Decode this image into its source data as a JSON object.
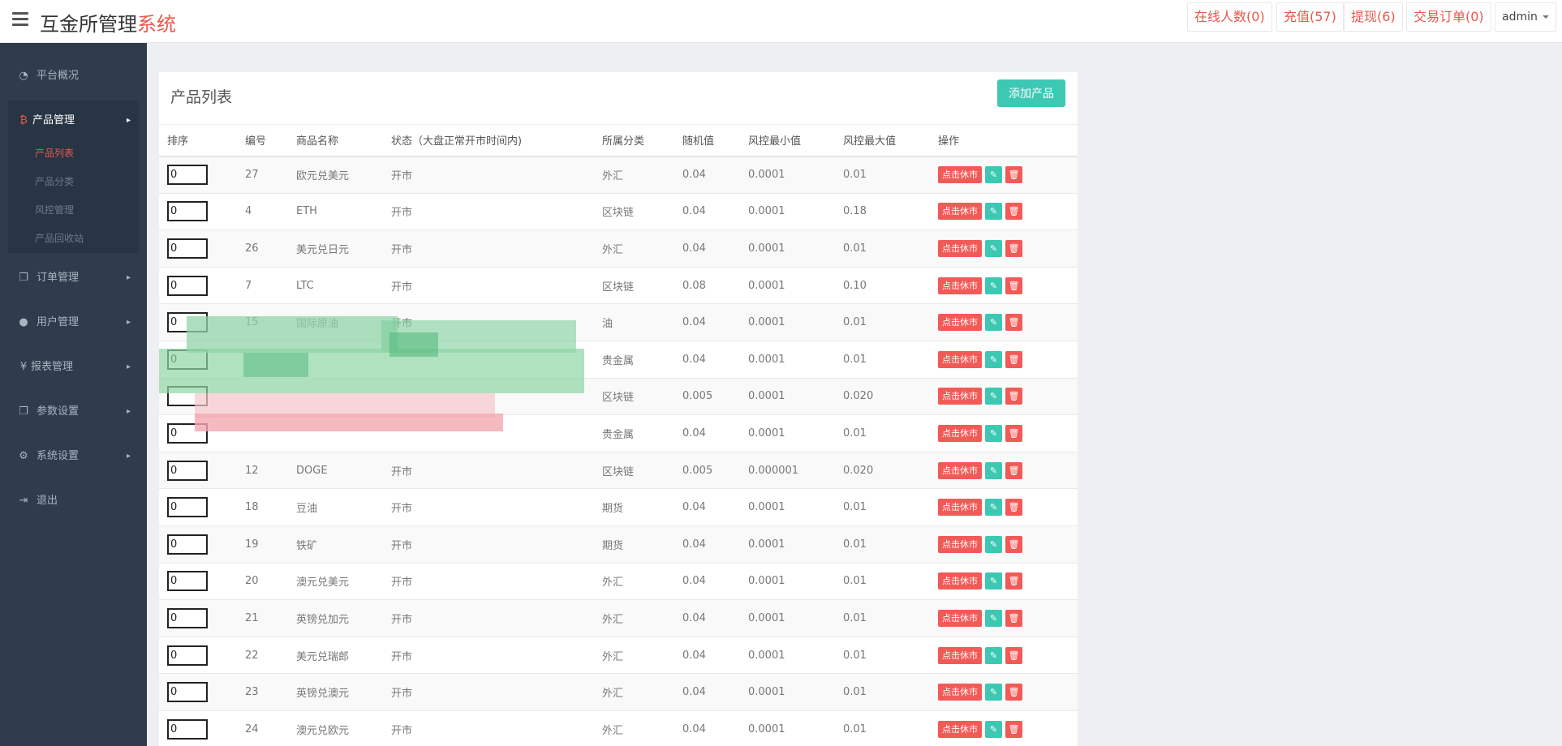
{
  "header": {
    "title_main": "互金所管理",
    "title_accent": "系统",
    "buttons": [
      {
        "label": "在线人数(0)"
      },
      {
        "label": "充值(57)"
      },
      {
        "label": "提现(6)"
      },
      {
        "label": "交易订单(0)"
      }
    ],
    "user": "admin"
  },
  "sidebar": {
    "items": [
      {
        "label": "平台概况",
        "icon": "dashboard-icon"
      },
      {
        "label": "产品管理",
        "icon": "bitcoin-icon"
      },
      {
        "label": "订单管理",
        "icon": "copy-icon"
      },
      {
        "label": "用户管理",
        "icon": "user-icon"
      },
      {
        "label": "报表管理",
        "icon": "yen-icon"
      },
      {
        "label": "参数设置",
        "icon": "copy-icon"
      },
      {
        "label": "系统设置",
        "icon": "cogs-icon"
      },
      {
        "label": "退出",
        "icon": "sign-out-icon"
      }
    ],
    "sub_items": [
      {
        "label": "产品列表"
      },
      {
        "label": "产品分类"
      },
      {
        "label": "风控管理"
      },
      {
        "label": "产品回收站"
      }
    ]
  },
  "panel": {
    "title": "产品列表",
    "add_button": "添加产品",
    "columns": [
      "排序",
      "编号",
      "商品名称",
      "状态（大盘正常开市时间内)",
      "所属分类",
      "随机值",
      "风控最小值",
      "风控最大值",
      "操作"
    ],
    "close_label": "点击休市",
    "rows": [
      {
        "sort": "0",
        "id": "27",
        "name": "欧元兑美元",
        "status": "开市",
        "category": "外汇",
        "random": "0.04",
        "min": "0.0001",
        "max": "0.01"
      },
      {
        "sort": "0",
        "id": "4",
        "name": "ETH",
        "status": "开市",
        "category": "区块链",
        "random": "0.04",
        "min": "0.0001",
        "max": "0.18"
      },
      {
        "sort": "0",
        "id": "26",
        "name": "美元兑日元",
        "status": "开市",
        "category": "外汇",
        "random": "0.04",
        "min": "0.0001",
        "max": "0.01"
      },
      {
        "sort": "0",
        "id": "7",
        "name": "LTC",
        "status": "开市",
        "category": "区块链",
        "random": "0.08",
        "min": "0.0001",
        "max": "0.10"
      },
      {
        "sort": "0",
        "id": "15",
        "name": "国际原油",
        "status": "开市",
        "category": "油",
        "random": "0.04",
        "min": "0.0001",
        "max": "0.01"
      },
      {
        "sort": "0",
        "id": "",
        "name": "",
        "status": "",
        "category": "贵金属",
        "random": "0.04",
        "min": "0.0001",
        "max": "0.01"
      },
      {
        "sort": "",
        "id": "",
        "name": "",
        "status": "",
        "category": "区块链",
        "random": "0.005",
        "min": "0.0001",
        "max": "0.020"
      },
      {
        "sort": "0",
        "id": "",
        "name": "",
        "status": "",
        "category": "贵金属",
        "random": "0.04",
        "min": "0.0001",
        "max": "0.01"
      },
      {
        "sort": "0",
        "id": "12",
        "name": "DOGE",
        "status": "开市",
        "category": "区块链",
        "random": "0.005",
        "min": "0.000001",
        "max": "0.020"
      },
      {
        "sort": "0",
        "id": "18",
        "name": "豆油",
        "status": "开市",
        "category": "期货",
        "random": "0.04",
        "min": "0.0001",
        "max": "0.01"
      },
      {
        "sort": "0",
        "id": "19",
        "name": "铁矿",
        "status": "开市",
        "category": "期货",
        "random": "0.04",
        "min": "0.0001",
        "max": "0.01"
      },
      {
        "sort": "0",
        "id": "20",
        "name": "澳元兑美元",
        "status": "开市",
        "category": "外汇",
        "random": "0.04",
        "min": "0.0001",
        "max": "0.01"
      },
      {
        "sort": "0",
        "id": "21",
        "name": "英镑兑加元",
        "status": "开市",
        "category": "外汇",
        "random": "0.04",
        "min": "0.0001",
        "max": "0.01"
      },
      {
        "sort": "0",
        "id": "22",
        "name": "美元兑瑞郎",
        "status": "开市",
        "category": "外汇",
        "random": "0.04",
        "min": "0.0001",
        "max": "0.01"
      },
      {
        "sort": "0",
        "id": "23",
        "name": "英镑兑澳元",
        "status": "开市",
        "category": "外汇",
        "random": "0.04",
        "min": "0.0001",
        "max": "0.01"
      },
      {
        "sort": "0",
        "id": "24",
        "name": "澳元兑欧元",
        "status": "开市",
        "category": "外汇",
        "random": "0.04",
        "min": "0.0001",
        "max": "0.01"
      }
    ]
  },
  "colors": {
    "accent": "#e9574c",
    "teal": "#3dc8b3",
    "sidebar": "#2f3c4c"
  }
}
